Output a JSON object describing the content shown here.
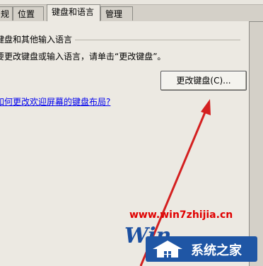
{
  "tabs": [
    {
      "label": "规"
    },
    {
      "label": "位置"
    },
    {
      "label": "键盘和语言"
    },
    {
      "label": "管理"
    }
  ],
  "keyboard": {
    "group_title": "键盘和其他输入语言",
    "description": "要更改键盘或输入语言，请单击“更改键盘”。",
    "change_button": "更改键盘(C)...",
    "help_link": "如何更改欢迎屏幕的键盘布局?"
  },
  "watermark": {
    "url": "www.win7zhijia.cn",
    "logo_letters": "Win",
    "home_text": "系统之家"
  },
  "colors": {
    "arrow": "#d42020",
    "link": "#0000ee",
    "watermark_url": "#e00000",
    "watermark_bg": "#1f56a5"
  }
}
